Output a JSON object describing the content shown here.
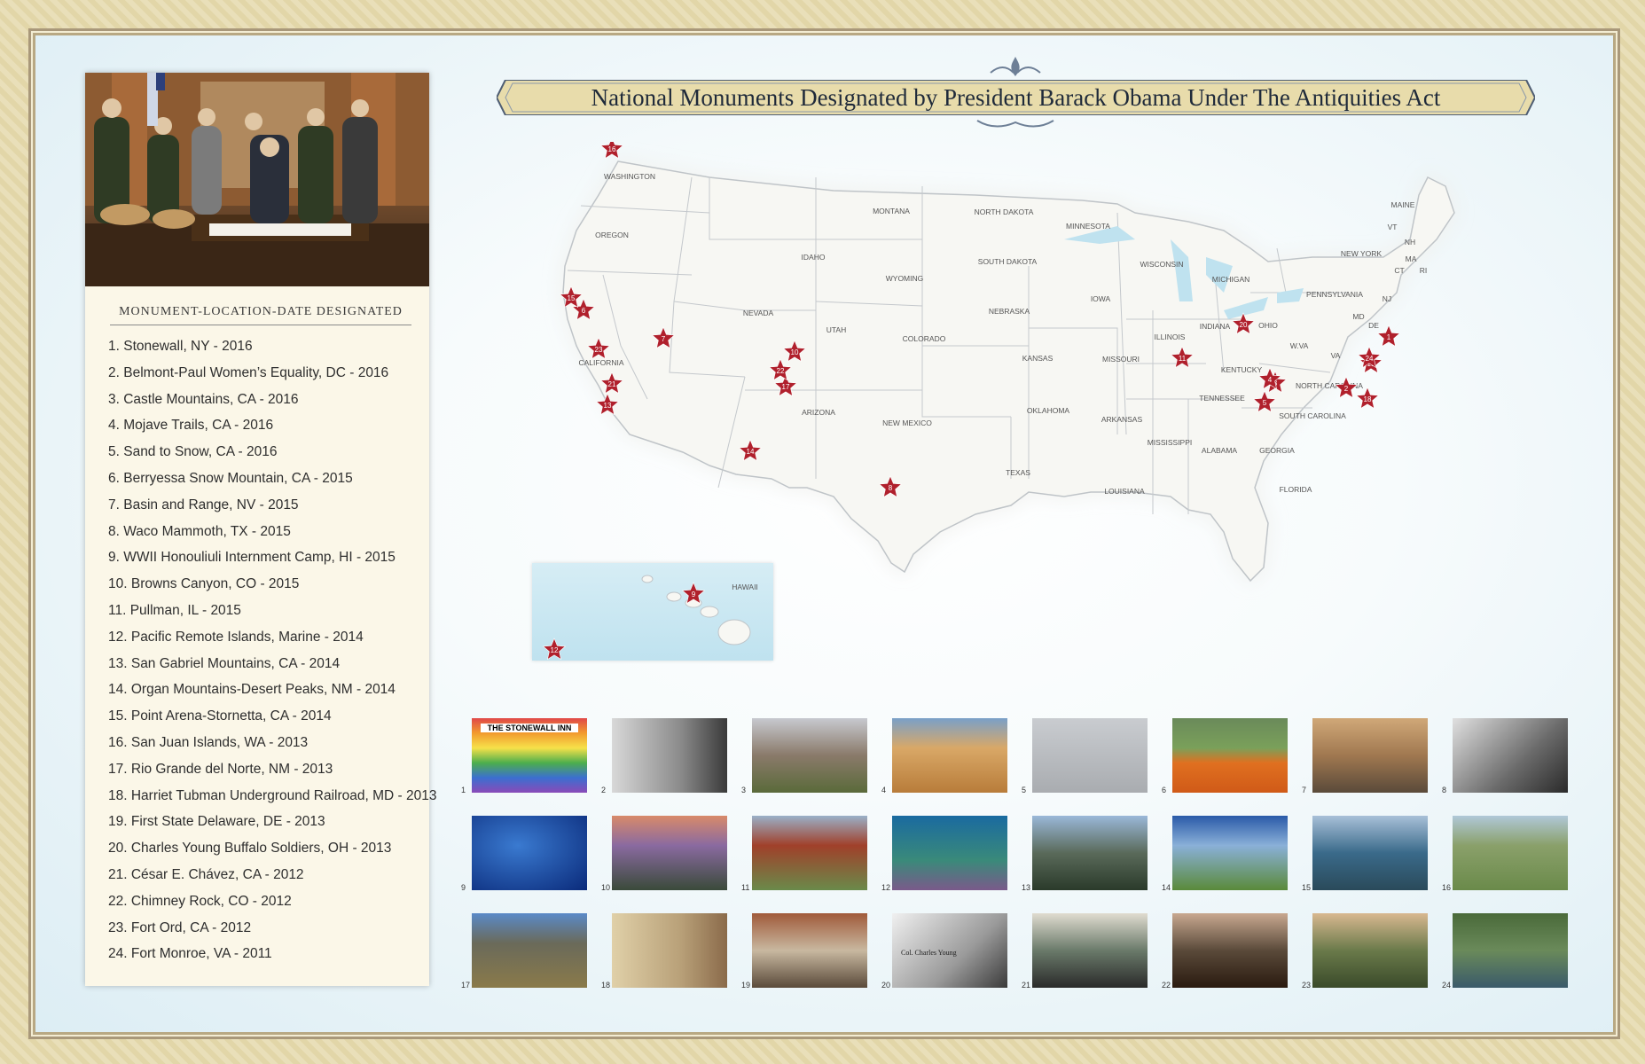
{
  "title": "National Monuments Designated by President Barack Obama Under The Antiquities Act",
  "sidebar": {
    "list_title": "MONUMENT-LOCATION-DATE DESIGNATED",
    "monuments": [
      "1. Stonewall, NY - 2016",
      "2. Belmont-Paul Women’s Equality, DC - 2016",
      "3. Castle Mountains, CA - 2016",
      "4. Mojave Trails, CA - 2016",
      "5. Sand to Snow, CA - 2016",
      "6. Berryessa Snow Mountain, CA - 2015",
      "7. Basin and Range, NV - 2015",
      "8. Waco Mammoth, TX - 2015",
      "9. WWII Honouliuli Internment Camp, HI - 2015",
      "10. Browns Canyon, CO - 2015",
      "11. Pullman, IL - 2015",
      "12. Pacific Remote Islands, Marine - 2014",
      "13. San Gabriel Mountains, CA - 2014",
      "14. Organ Mountains-Desert Peaks, NM - 2014",
      "15. Point Arena-Stornetta, CA - 2014",
      "16. San Juan Islands, WA - 2013",
      "17. Rio Grande del Norte, NM - 2013",
      "18. Harriet Tubman Underground Railroad, MD - 2013",
      "19. First State Delaware, DE - 2013",
      "20. Charles Young Buffalo Soldiers, OH - 2013",
      "21. César E. Chávez, CA - 2012",
      "22. Chimney Rock, CO - 2012",
      "23. Fort Ord, CA - 2012",
      "24. Fort Monroe, VA - 2011"
    ]
  },
  "map": {
    "state_labels": [
      "WASHINGTON",
      "OREGON",
      "CALIFORNIA",
      "NEVADA",
      "IDAHO",
      "MONTANA",
      "WYOMING",
      "UTAH",
      "ARIZONA",
      "COLORADO",
      "NEW MEXICO",
      "NORTH DAKOTA",
      "SOUTH DAKOTA",
      "NEBRASKA",
      "KANSAS",
      "OKLAHOMA",
      "TEXAS",
      "MINNESOTA",
      "IOWA",
      "MISSOURI",
      "ARKANSAS",
      "LOUISIANA",
      "WISCONSIN",
      "ILLINOIS",
      "MICHIGAN",
      "INDIANA",
      "OHIO",
      "KENTUCKY",
      "TENNESSEE",
      "MISSISSIPPI",
      "ALABAMA",
      "GEORGIA",
      "FLORIDA",
      "SOUTH CAROLINA",
      "NORTH CAROLINA",
      "VA",
      "W.VA",
      "PENNSYLVANIA",
      "NEW YORK",
      "MAINE",
      "VT",
      "NH",
      "MA",
      "CT",
      "RI",
      "NJ",
      "MD",
      "DE",
      "HAWAII"
    ],
    "marker_numbers": [
      "1",
      "2",
      "3",
      "4",
      "5",
      "6",
      "7",
      "8",
      "9",
      "10",
      "11",
      "12",
      "13",
      "14",
      "15",
      "16",
      "17",
      "18",
      "19",
      "20",
      "21",
      "22",
      "23",
      "24"
    ],
    "marker_color": "#b0202c"
  },
  "thumbnails": [
    "1",
    "2",
    "3",
    "4",
    "5",
    "6",
    "7",
    "8",
    "9",
    "10",
    "11",
    "12",
    "13",
    "14",
    "15",
    "16",
    "17",
    "18",
    "19",
    "20",
    "21",
    "22",
    "23",
    "24"
  ],
  "thumb_captions": {
    "t1": "THE STONEWALL INN",
    "t20": "Col. Charles Young"
  },
  "colors": {
    "frame": "#e9dfb9",
    "sidebar": "#fbf7e8",
    "banner": "#e8dcab",
    "ocean": "#bfe2ef",
    "land": "#f7f7f3",
    "marker": "#b0202c"
  }
}
